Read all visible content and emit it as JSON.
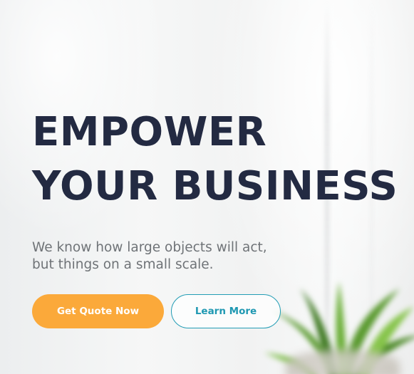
{
  "hero": {
    "title_lines": [
      "EMPOWER",
      "YOUR BUSINESS"
    ],
    "subtitle_lines": [
      "We know how large objects will act,",
      "but things on a small scale."
    ],
    "primary_button_label": "Get Quote Now",
    "secondary_button_label": "Learn More"
  },
  "colors": {
    "title": "#232a42",
    "subtitle": "#6f7377",
    "primary_button": "#fba93a",
    "secondary_button_border": "#239db5",
    "secondary_button_text": "#1f98b2"
  },
  "background": {
    "image": "blurred office wall with green potted plant"
  }
}
